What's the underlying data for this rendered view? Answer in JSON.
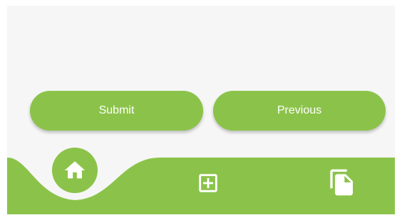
{
  "buttons": {
    "submit_label": "Submit",
    "previous_label": "Previous"
  },
  "bottom_nav": {
    "items": [
      {
        "icon": "home-icon",
        "active": true
      },
      {
        "icon": "add-box-icon",
        "active": false
      },
      {
        "icon": "file-copy-icon",
        "active": false
      }
    ]
  },
  "colors": {
    "accent": "#8bc34a",
    "background": "#f6f6f6",
    "on_accent": "#ffffff"
  }
}
